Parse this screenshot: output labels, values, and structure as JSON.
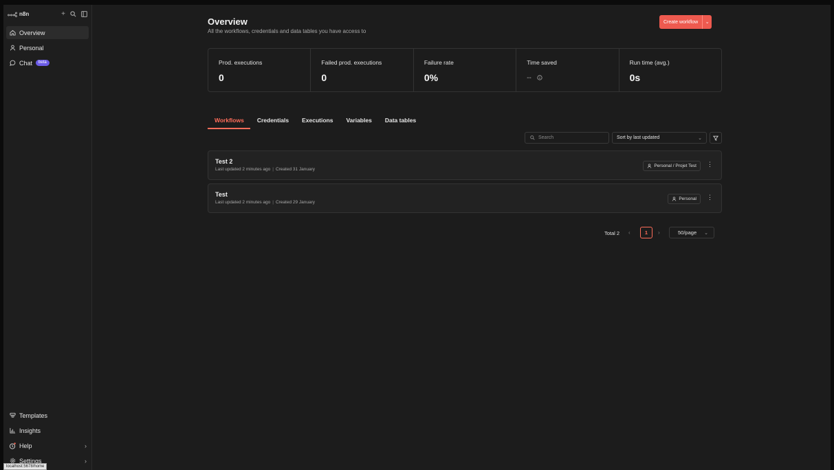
{
  "app": {
    "name": "n8n",
    "status_url": "localhost:5678/home"
  },
  "sidebar": {
    "items": [
      {
        "label": "Overview",
        "icon": "home-icon",
        "active": true
      },
      {
        "label": "Personal",
        "icon": "user-icon"
      },
      {
        "label": "Chat",
        "icon": "chat-icon",
        "badge": "beta"
      }
    ],
    "bottom_items": [
      {
        "label": "Templates",
        "icon": "templates-icon"
      },
      {
        "label": "Insights",
        "icon": "insights-icon"
      },
      {
        "label": "Help",
        "icon": "help-icon",
        "has_chevron": true
      },
      {
        "label": "Settings",
        "icon": "settings-icon",
        "has_chevron": true
      }
    ]
  },
  "header": {
    "title": "Overview",
    "subtitle": "All the workflows, credentials and data tables you have access to",
    "create_label": "Create workflow"
  },
  "stats": [
    {
      "label": "Prod. executions",
      "value": "0"
    },
    {
      "label": "Failed prod. executions",
      "value": "0"
    },
    {
      "label": "Failure rate",
      "value": "0%"
    },
    {
      "label": "Time saved",
      "value": "--"
    },
    {
      "label": "Run time (avg.)",
      "value": "0s"
    }
  ],
  "tabs": [
    "Workflows",
    "Credentials",
    "Executions",
    "Variables",
    "Data tables"
  ],
  "active_tab": "Workflows",
  "filters": {
    "search_placeholder": "Search",
    "sort_label": "Sort by last updated"
  },
  "workflows": [
    {
      "name": "Test 2",
      "updated": "Last updated 2 minutes ago",
      "created": "Created 31 January",
      "project": "Personal / Projet Test"
    },
    {
      "name": "Test",
      "updated": "Last updated 2 minutes ago",
      "created": "Created 29 January",
      "project": "Personal"
    }
  ],
  "pagination": {
    "total_label": "Total 2",
    "current_page": "1",
    "page_size": "50/page"
  },
  "colors": {
    "accent": "#ff6d5a",
    "button": "#ee5a4f",
    "badge": "#6c5ce7",
    "background": "#1c1c1c"
  }
}
